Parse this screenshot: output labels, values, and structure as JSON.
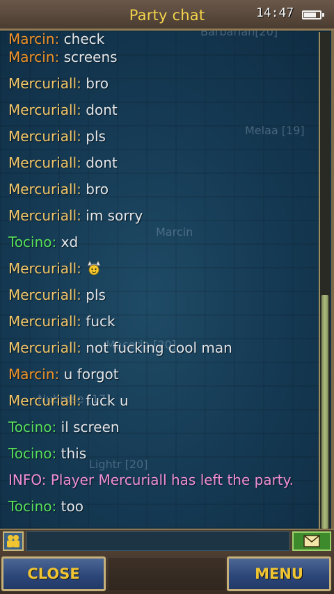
{
  "header": {
    "title": "Party chat",
    "clock": "14:47",
    "battery_level": 0.75
  },
  "background_labels": [
    "Barbarian[20]",
    "Melaa [19]",
    "Marcin",
    "Macerio [20]",
    "Nubrose [17]",
    "Lightr [20]"
  ],
  "messages": [
    {
      "name": "Marcin",
      "text": "check",
      "color": "#f0932b"
    },
    {
      "name": "Marcin",
      "text": "screens",
      "color": "#f0932b"
    },
    {
      "name": "Mercuriall",
      "text": "bro",
      "color": "#f2c66a"
    },
    {
      "name": "Mercuriall",
      "text": "dont",
      "color": "#f2c66a"
    },
    {
      "name": "Mercuriall",
      "text": "pls",
      "color": "#f2c66a"
    },
    {
      "name": "Mercuriall",
      "text": "dont",
      "color": "#f2c66a"
    },
    {
      "name": "Mercuriall",
      "text": "bro",
      "color": "#f2c66a"
    },
    {
      "name": "Mercuriall",
      "text": "im sorry",
      "color": "#f2c66a"
    },
    {
      "name": "Tocino",
      "text": "xd",
      "color": "#58df5c"
    },
    {
      "name": "Mercuriall",
      "text": "",
      "icon": "viking-smiley-emote-icon",
      "color": "#f2c66a"
    },
    {
      "name": "Mercuriall",
      "text": "pls",
      "color": "#f2c66a"
    },
    {
      "name": "Mercuriall",
      "text": "fuck",
      "color": "#f2c66a"
    },
    {
      "name": "Mercuriall",
      "text": "not fucking cool man",
      "color": "#f2c66a"
    },
    {
      "name": "Marcin",
      "text": "u forgot",
      "color": "#f0932b"
    },
    {
      "name": "Mercuriall",
      "text": "fuck u",
      "color": "#f2c66a"
    },
    {
      "name": "Tocino",
      "text": "il screen",
      "color": "#58df5c"
    },
    {
      "name": "Tocino",
      "text": "this",
      "color": "#58df5c"
    },
    {
      "name": "INFO",
      "text": "Player Mercuriall has left the party.",
      "color": "#f08fd6",
      "body_color": "#f08fd6"
    },
    {
      "name": "Tocino",
      "text": "too",
      "color": "#58df5c"
    }
  ],
  "scrollbar": {
    "position": 0.32,
    "visible_fraction": 0.68
  },
  "input": {
    "value": "",
    "members_icon": "party-members-icon",
    "send_icon": "envelope-send-icon"
  },
  "buttons": {
    "close": "CLOSE",
    "menu": "MENU"
  }
}
